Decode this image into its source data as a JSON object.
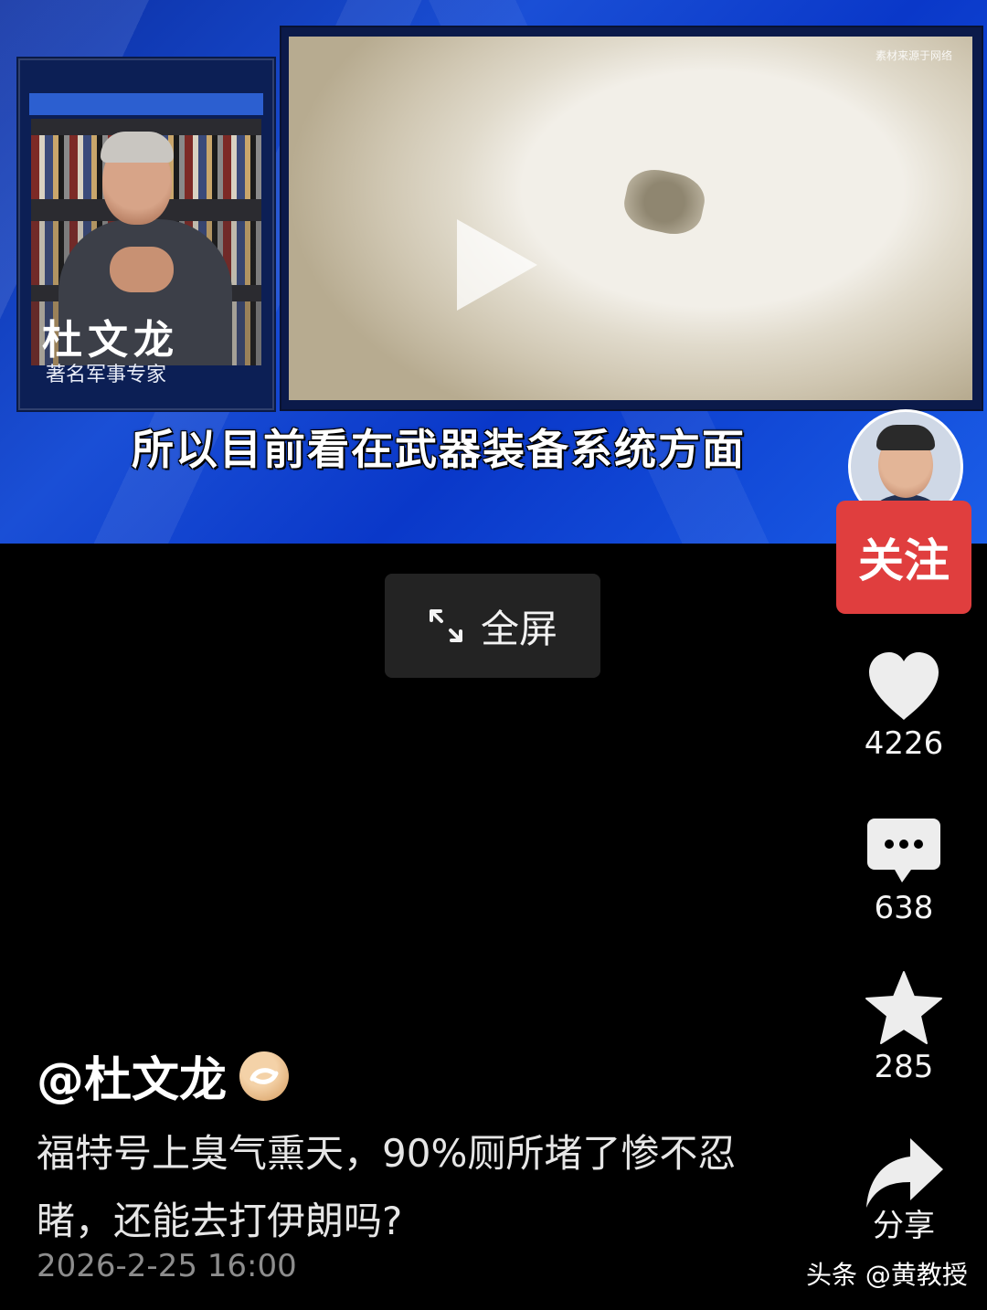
{
  "video": {
    "speaker_name": "杜文龙",
    "speaker_title": "著名军事专家",
    "clip_source": "素材来源于网络",
    "subtitle": "所以目前看在武器装备系统方面"
  },
  "fullscreen": {
    "label": "全屏",
    "icon": "expand-icon"
  },
  "actions": {
    "follow_label": "关注",
    "like_count": "4226",
    "comment_count": "638",
    "favorite_count": "285",
    "share_label": "分享"
  },
  "post": {
    "author": "@杜文龙",
    "caption": "福特号上臭气熏天，90%厕所堵了惨不忍睹，还能去打伊朗吗?",
    "date": "2026-2-25 16:00"
  },
  "watermark": "头条 @黄教授",
  "colors": {
    "follow": "#e03e3e",
    "background": "#000000",
    "video_blue": "#1a4fd6"
  }
}
